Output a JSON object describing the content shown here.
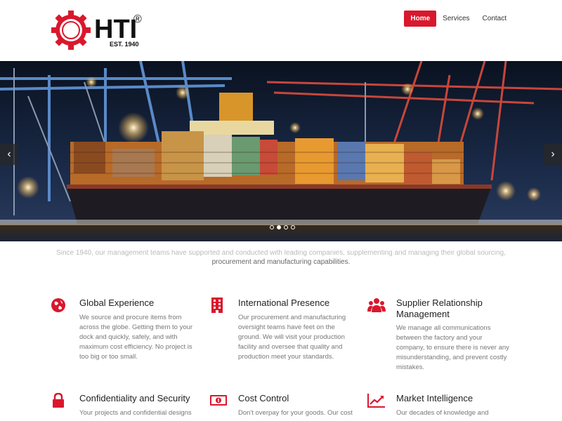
{
  "brand": {
    "name": "HTI",
    "registered": "®",
    "est": "EST. 1940",
    "accent_color": "#d9182d"
  },
  "nav": {
    "items": [
      {
        "label": "Home",
        "active": true
      },
      {
        "label": "Services",
        "active": false
      },
      {
        "label": "Contact",
        "active": false
      }
    ]
  },
  "hero": {
    "prev_icon": "chevron-left-icon",
    "next_icon": "chevron-right-icon",
    "prev_label": "‹",
    "next_label": "›",
    "slide_count": 4,
    "active_slide": 2
  },
  "intro": {
    "faded_line": "Since 1940, our management teams have supported and conducted with leading companies, supplementing and managing their global sourcing,",
    "line": "procurement and manufacturing capabilities."
  },
  "features": [
    {
      "icon": "globe-icon",
      "title": "Global Experience",
      "body": "We source and procure items from across the globe. Getting them to your dock and quickly, safely, and with maximum cost efficiency. No project is too big or too small."
    },
    {
      "icon": "building-icon",
      "title": "International Presence",
      "body": "Our procurement and manufacturing oversight teams have feet on the ground. We will visit your production facility and oversee that quality and production meet your standards."
    },
    {
      "icon": "users-icon",
      "title": "Supplier Relationship Management",
      "body": "We manage all communications between the factory and your company, to ensure there is never any misunderstanding, and prevent costly mistakes."
    },
    {
      "icon": "lock-icon",
      "title": "Confidentiality and Security",
      "body": "Your projects and confidential designs"
    },
    {
      "icon": "money-icon",
      "title": "Cost Control",
      "body": "Don't overpay for your goods. Our cost"
    },
    {
      "icon": "trend-chart-icon",
      "title": "Market Intelligence",
      "body": "Our decades of knowledge and"
    }
  ]
}
